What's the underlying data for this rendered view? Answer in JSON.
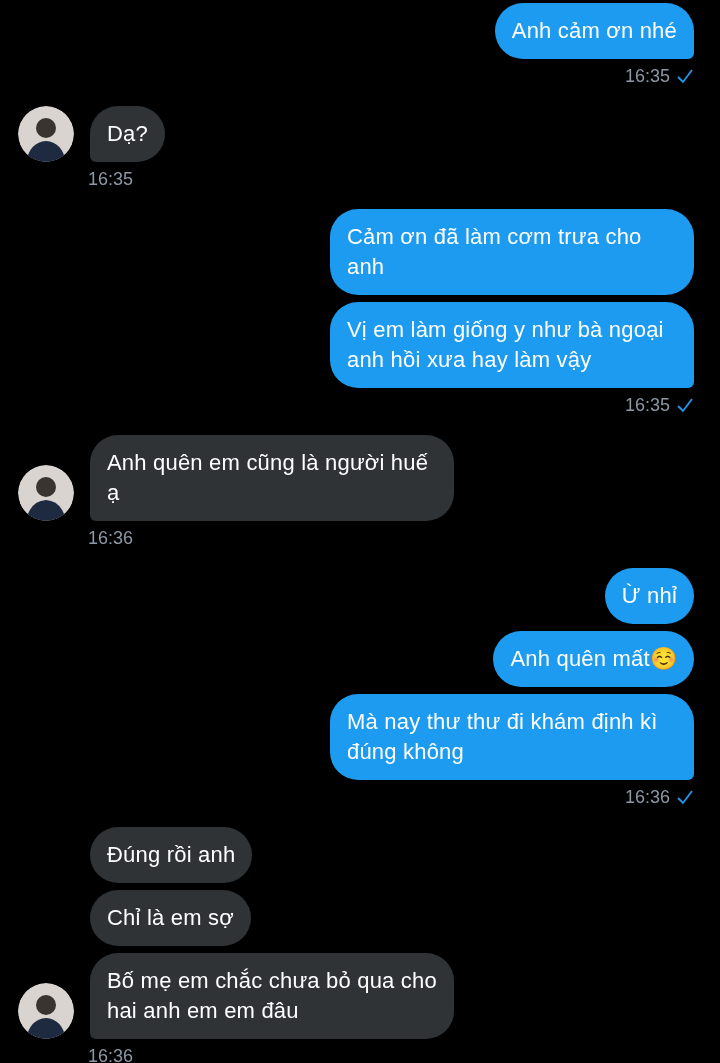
{
  "groups": [
    {
      "kind": "sent",
      "messages": [
        "Anh cảm ơn nhé"
      ],
      "time": "16:35",
      "delivered": true
    },
    {
      "kind": "received",
      "messages": [
        "Dạ?"
      ],
      "time": "16:35"
    },
    {
      "kind": "sent",
      "messages": [
        "Cảm ơn đã làm cơm trưa cho anh",
        "Vị em làm giống y như bà ngoại anh hồi xưa hay làm vậy"
      ],
      "time": "16:35",
      "delivered": true
    },
    {
      "kind": "received",
      "messages": [
        "Anh quên em cũng là người huế ạ"
      ],
      "time": "16:36"
    },
    {
      "kind": "sent",
      "messages": [
        "Ừ nhỉ",
        "Anh quên mất☺️",
        "Mà nay thư thư đi khám định kì đúng không"
      ],
      "time": "16:36",
      "delivered": true
    },
    {
      "kind": "received",
      "messages": [
        "Đúng rồi anh",
        "Chỉ là em sợ",
        "Bố mẹ em chắc chưa bỏ qua cho hai anh em em đâu"
      ],
      "time": "16:36"
    }
  ]
}
